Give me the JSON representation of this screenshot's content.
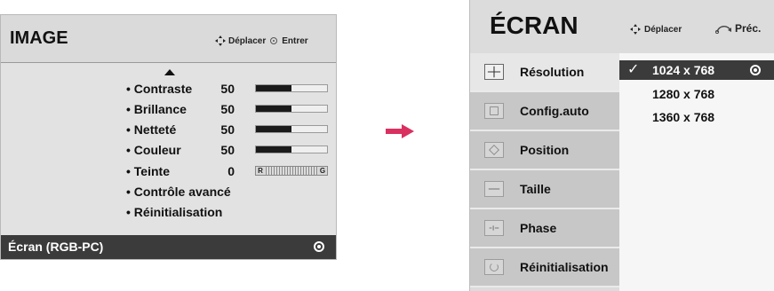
{
  "left_menu": {
    "title": "IMAGE",
    "hint_move": "Déplacer",
    "hint_enter": "Entrer",
    "items": [
      {
        "label": "• Contraste",
        "value": "50",
        "level": 0.5
      },
      {
        "label": "• Brillance",
        "value": "50",
        "level": 0.5
      },
      {
        "label": "• Netteté",
        "value": "50",
        "level": 0.5
      },
      {
        "label": "• Couleur",
        "value": "50",
        "level": 0.5
      },
      {
        "label": "• Teinte",
        "value": "0",
        "tint_left": "R",
        "tint_right": "G"
      },
      {
        "label": "• Contrôle avancé"
      },
      {
        "label": "• Réinitialisation"
      }
    ],
    "selected_item": "Écran (RGB-PC)"
  },
  "right_menu": {
    "title": "ÉCRAN",
    "hint_move": "Déplacer",
    "hint_back": "Préc.",
    "tabs": [
      {
        "label": "Résolution",
        "active": true,
        "icon": "crosshair-icon"
      },
      {
        "label": "Config.auto",
        "icon": "auto-config-icon"
      },
      {
        "label": "Position",
        "icon": "position-icon"
      },
      {
        "label": "Taille",
        "icon": "size-icon"
      },
      {
        "label": "Phase",
        "icon": "phase-icon"
      },
      {
        "label": "Réinitialisation",
        "icon": "reset-icon"
      }
    ],
    "options": [
      {
        "label": "1024 x 768",
        "selected": true
      },
      {
        "label": "1280 x 768"
      },
      {
        "label": "1360 x 768"
      }
    ]
  },
  "colors": {
    "accent_arrow": "#d9305f",
    "highlight": "#3b3b3b"
  }
}
